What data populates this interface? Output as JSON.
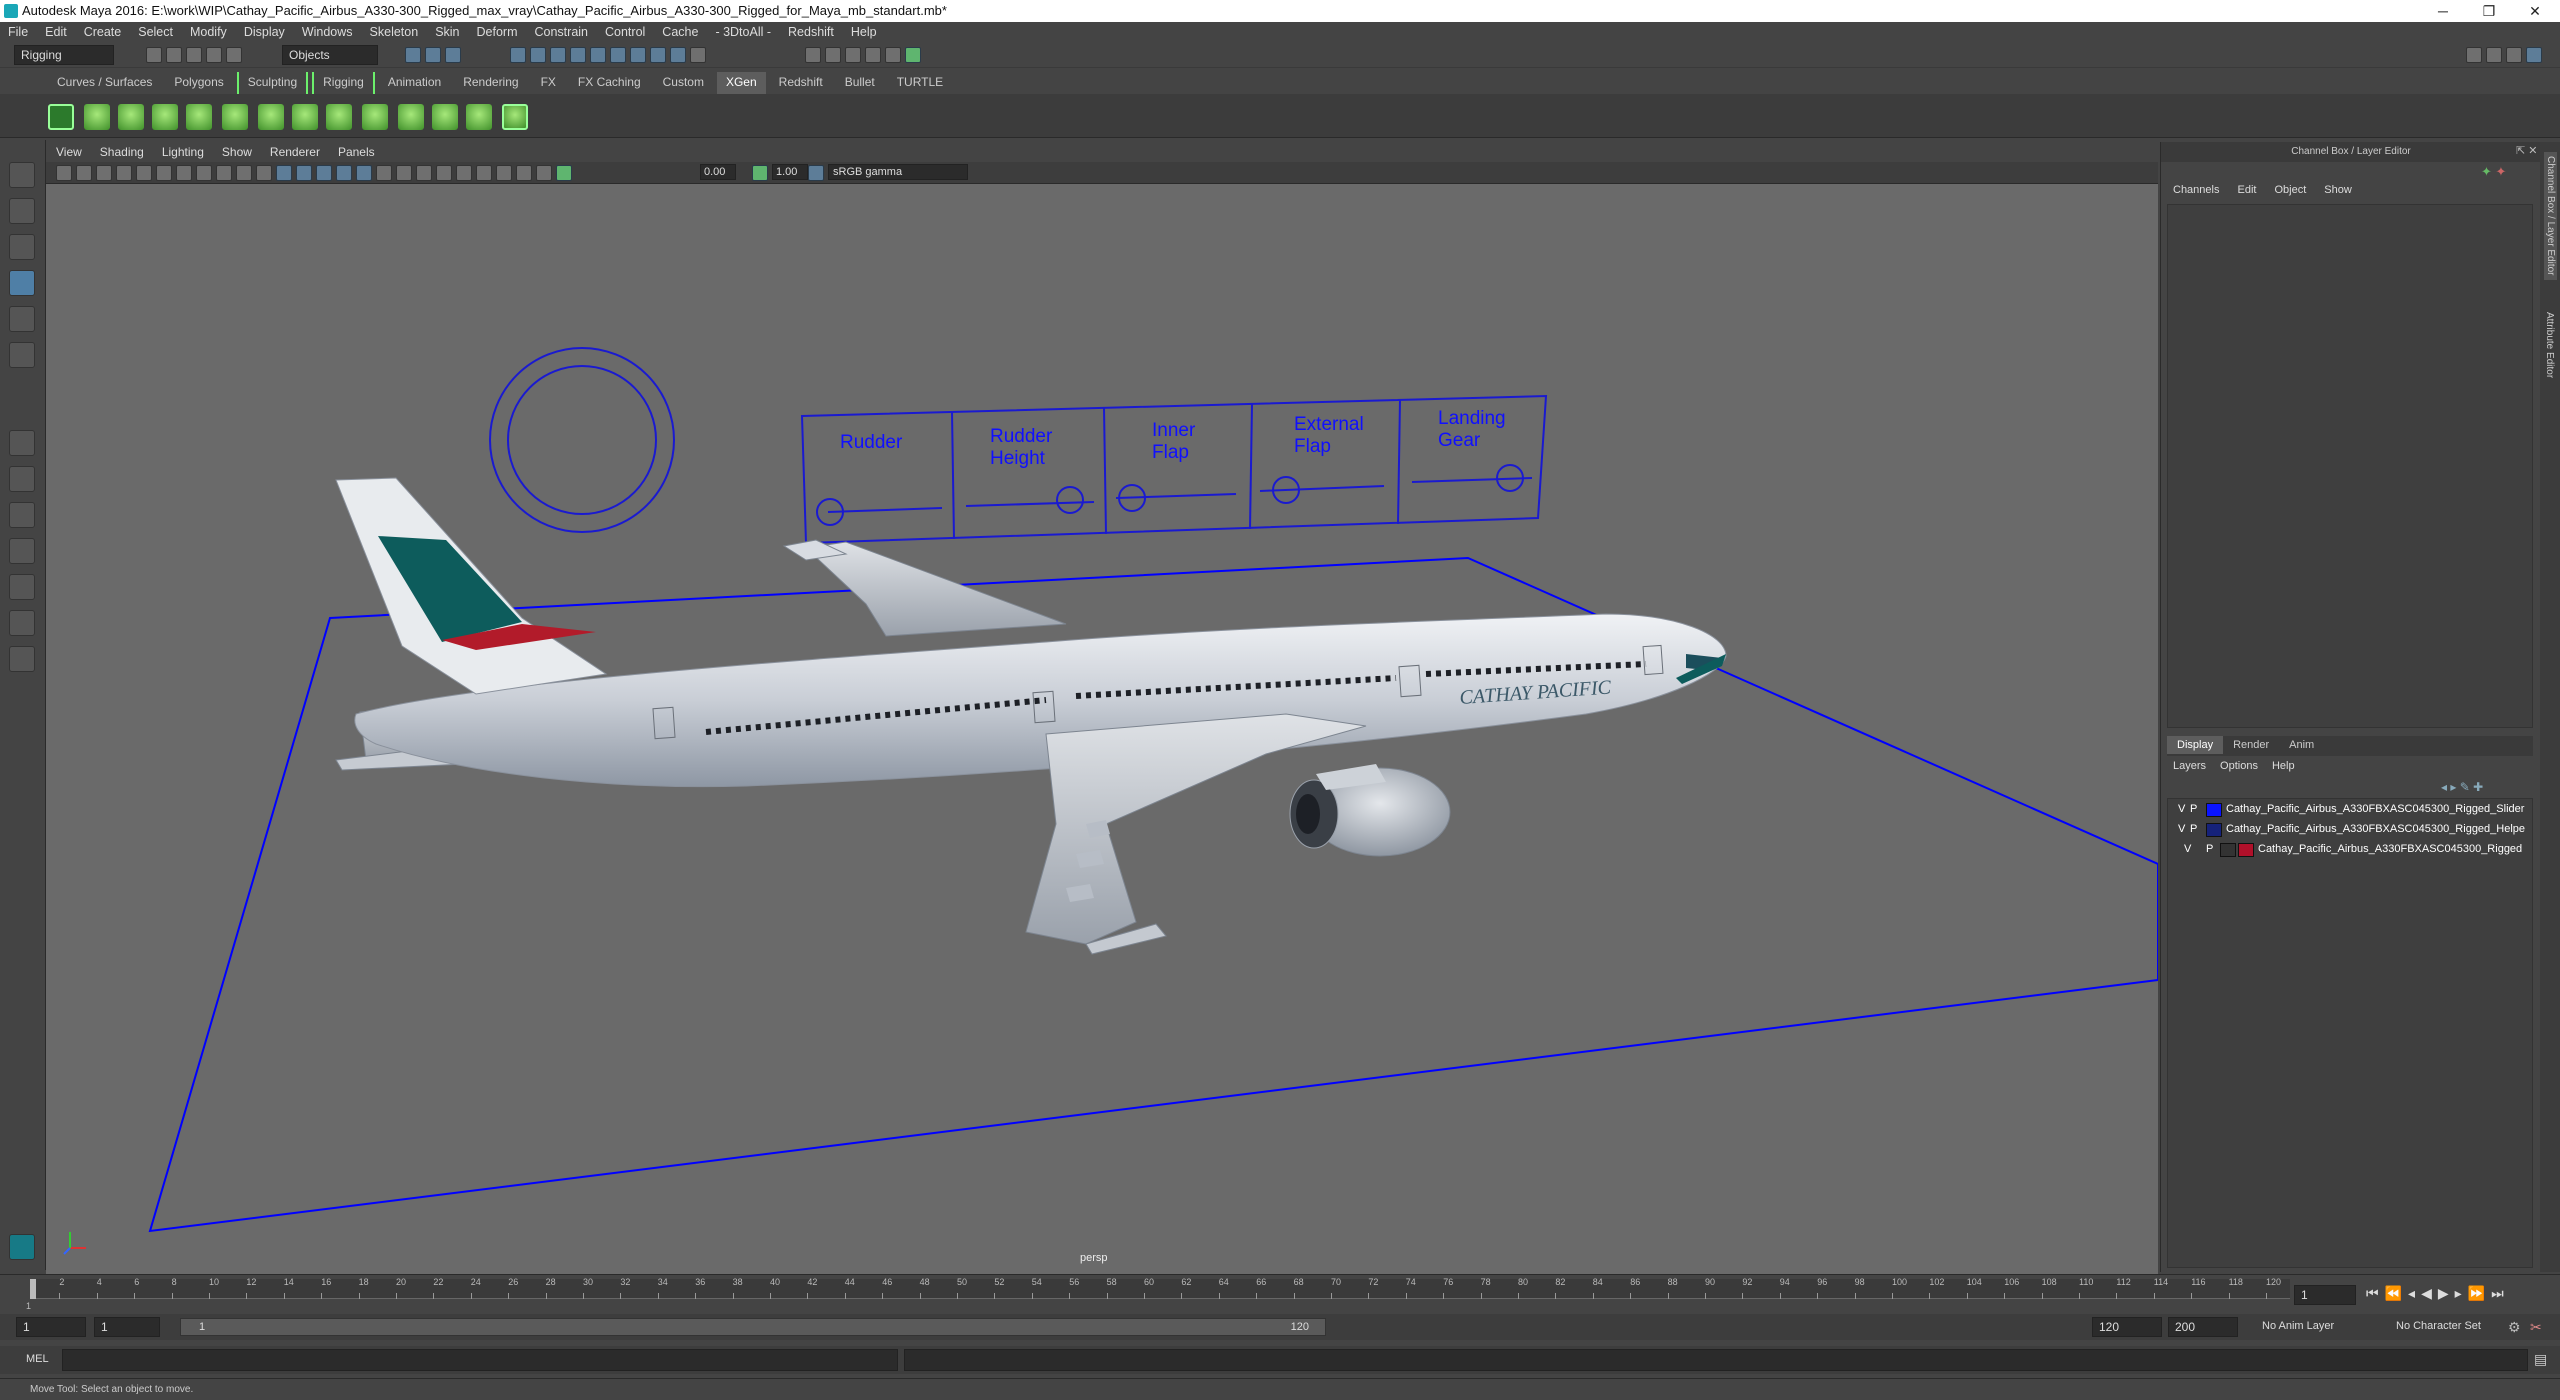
{
  "titlebar": {
    "title": "Autodesk Maya 2016: E:\\work\\WIP\\Cathay_Pacific_Airbus_A330-300_Rigged_max_vray\\Cathay_Pacific_Airbus_A330-300_Rigged_for_Maya_mb_standart.mb*",
    "minimize": "─",
    "restore": "❐",
    "close": "✕"
  },
  "menubar": [
    "File",
    "Edit",
    "Create",
    "Select",
    "Modify",
    "Display",
    "Windows",
    "Skeleton",
    "Skin",
    "Deform",
    "Constrain",
    "Control",
    "Cache",
    "- 3DtoAll -",
    "Redshift",
    "Help"
  ],
  "statusline": {
    "menuset": "Rigging",
    "select_mode": "Objects"
  },
  "shelf": {
    "tabs": [
      "Curves / Surfaces",
      "Polygons",
      "Sculpting",
      "Rigging",
      "Animation",
      "Rendering",
      "FX",
      "FX Caching",
      "Custom",
      "XGen",
      "Redshift",
      "Bullet",
      "TURTLE"
    ],
    "active_tab": "XGen"
  },
  "viewport": {
    "menu": [
      "View",
      "Shading",
      "Lighting",
      "Show",
      "Renderer",
      "Panels"
    ],
    "exposure": "0.00",
    "gamma": "1.00",
    "colorspace": "sRGB gamma",
    "camera_label": "persp",
    "control_labels": [
      [
        "Rudder"
      ],
      [
        "Rudder",
        "Height"
      ],
      [
        "Inner",
        "Flap"
      ],
      [
        "External",
        "Flap"
      ],
      [
        "Landing",
        "Gear"
      ]
    ],
    "fuselage_text": "CATHAY PACIFIC",
    "colors": {
      "wire": "#0000ff",
      "bg": "#6a6a6a",
      "tail": "#0d5c5c"
    }
  },
  "channelbox": {
    "header": "Channel Box / Layer Editor",
    "menu": [
      "Channels",
      "Edit",
      "Object",
      "Show"
    ]
  },
  "layers": {
    "tabs": [
      "Display",
      "Render",
      "Anim"
    ],
    "active_tab": "Display",
    "menu": [
      "Layers",
      "Options",
      "Help"
    ],
    "rows": [
      {
        "v": "V",
        "p": "P",
        "color": "#0a14ff",
        "name": "Cathay_Pacific_Airbus_A330FBXASC045300_Rigged_Slider"
      },
      {
        "v": "V",
        "p": "P",
        "color": "#16227a",
        "name": "Cathay_Pacific_Airbus_A330FBXASC045300_Rigged_Helpe"
      },
      {
        "v": "V",
        "p": "P",
        "color": "#b0102a",
        "name": "Cathay_Pacific_Airbus_A330FBXASC045300_Rigged"
      }
    ]
  },
  "side_tabs": [
    "Channel Box / Layer Editor",
    "Attribute Editor"
  ],
  "timeline": {
    "ticks": [
      "2",
      "4",
      "6",
      "8",
      "10",
      "12",
      "14",
      "16",
      "18",
      "20",
      "22",
      "24",
      "26",
      "28",
      "30",
      "32",
      "34",
      "36",
      "38",
      "40",
      "42",
      "44",
      "46",
      "48",
      "50",
      "52",
      "54",
      "56",
      "58",
      "60",
      "62",
      "64",
      "66",
      "68",
      "70",
      "72",
      "74",
      "76",
      "78",
      "80",
      "82",
      "84",
      "86",
      "88",
      "90",
      "92",
      "94",
      "96",
      "98",
      "100",
      "102",
      "104",
      "106",
      "108",
      "110",
      "112",
      "114",
      "116",
      "118",
      "120"
    ],
    "first_tick": "1",
    "current_frame": "1"
  },
  "range": {
    "start": "1",
    "inner_start": "1",
    "slider_start": "1",
    "slider_end": "120",
    "end": "120",
    "max": "200",
    "anim_layer": "No Anim Layer",
    "char_set": "No Character Set"
  },
  "cmdline": {
    "lang": "MEL"
  },
  "helpline": {
    "text": "Move Tool: Select an object to move."
  }
}
